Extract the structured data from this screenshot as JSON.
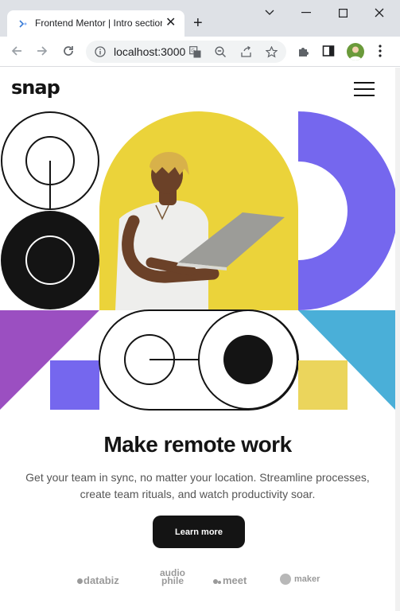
{
  "browser": {
    "tab_title": "Frontend Mentor | Intro section with dropdown navigation",
    "tab_close": "✕",
    "new_tab": "+",
    "url": "localhost:3000",
    "colors": {
      "chrome": "#dee1e6",
      "omnibox": "#f1f3f4"
    }
  },
  "site": {
    "logo": "snap",
    "headline": "Make remote work",
    "subtext": "Get your team in sync, no matter your location. Streamline processes, create team rituals, and watch productivity soar.",
    "cta_label": "Learn more",
    "clients": [
      "databiz",
      "audio phile",
      "meet",
      "maker"
    ],
    "colors": {
      "ink": "#141414",
      "purple": "#7567ee",
      "yellow": "#ebd33a",
      "violet": "#9b4fc1",
      "teal": "#4aafd8",
      "sand": "#ebd55c"
    }
  },
  "icons": [
    "favicon-icon",
    "close-icon",
    "plus-icon",
    "minimize-icon",
    "maximize-icon",
    "window-close-icon",
    "chevron-down-icon",
    "back-arrow-icon",
    "forward-arrow-icon",
    "reload-icon",
    "site-info-icon",
    "translate-icon",
    "zoom-out-icon",
    "share-icon",
    "bookmark-star-icon",
    "extensions-icon",
    "side-panel-icon",
    "profile-avatar-icon",
    "kebab-menu-icon",
    "hamburger-menu-icon"
  ]
}
